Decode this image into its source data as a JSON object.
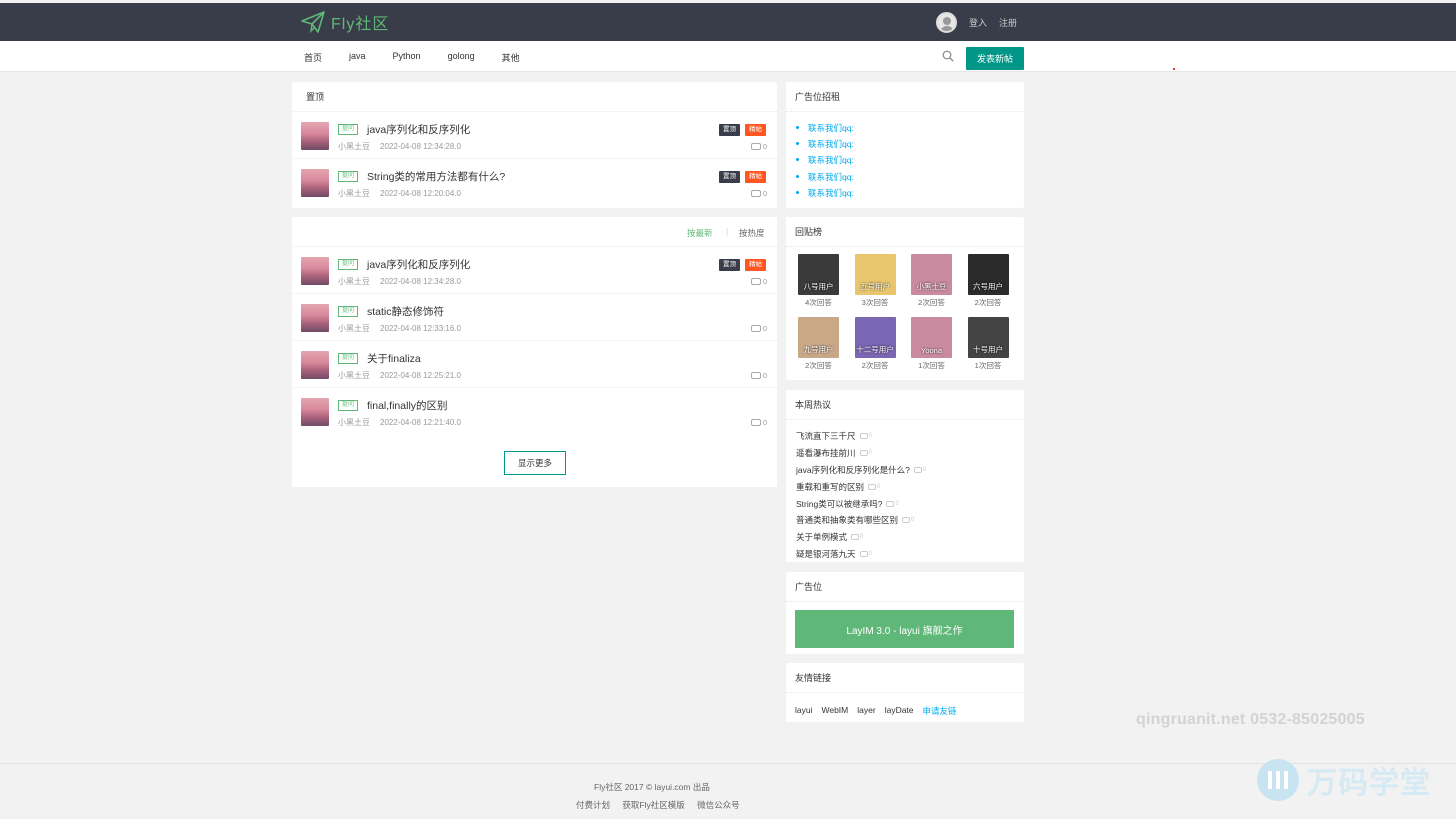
{
  "header": {
    "logo_text": "Fly社区",
    "login": "登入",
    "register": "注册"
  },
  "nav": {
    "items": [
      "首页",
      "java",
      "Python",
      "golong",
      "其他"
    ],
    "post_button": "发表新帖"
  },
  "top_panel": {
    "title": "置顶",
    "posts": [
      {
        "category": "提问",
        "title": "java序列化和反序列化",
        "author": "小黑土豆",
        "date": "2022-04-08 12:34:28.0",
        "badges": [
          "置顶",
          "精帖"
        ],
        "comments": "0"
      },
      {
        "category": "提问",
        "title": "String类的常用方法都有什么?",
        "author": "小黑土豆",
        "date": "2022-04-08 12:20:04.0",
        "badges": [
          "置顶",
          "精帖"
        ],
        "comments": "0"
      }
    ]
  },
  "list_panel": {
    "sort_latest": "按最新",
    "sort_sep": "|",
    "sort_hot": "按热度",
    "posts": [
      {
        "category": "提问",
        "title": "java序列化和反序列化",
        "author": "小黑土豆",
        "date": "2022-04-08 12:34:28.0",
        "badges": [
          "置顶",
          "精帖"
        ],
        "comments": "0"
      },
      {
        "category": "提问",
        "title": "static静态修饰符",
        "author": "小黑土豆",
        "date": "2022-04-08 12:33:16.0",
        "badges": [],
        "comments": "0"
      },
      {
        "category": "提问",
        "title": "关于finaliza",
        "author": "小黑土豆",
        "date": "2022-04-08 12:25:21.0",
        "badges": [],
        "comments": "0"
      },
      {
        "category": "提问",
        "title": "final,finally的区别",
        "author": "小黑土豆",
        "date": "2022-04-08 12:21:40.0",
        "badges": [],
        "comments": "0"
      }
    ],
    "more_button": "显示更多"
  },
  "ad_panel": {
    "title": "广告位招租",
    "links": [
      "联系我们qq:",
      "联系我们qq:",
      "联系我们qq:",
      "联系我们qq:",
      "联系我们qq:"
    ]
  },
  "reply_panel": {
    "title": "回贴榜",
    "users": [
      {
        "name": "八号用户",
        "count": "4次回答",
        "color": "#3a3a3a"
      },
      {
        "name": "五号用户",
        "count": "3次回答",
        "color": "#e9c66e"
      },
      {
        "name": "小黑土豆",
        "count": "2次回答",
        "color": "#c98aa0"
      },
      {
        "name": "六号用户",
        "count": "2次回答",
        "color": "#2b2b2b"
      },
      {
        "name": "九号用户",
        "count": "2次回答",
        "color": "#c9a888"
      },
      {
        "name": "十二号用户",
        "count": "2次回答",
        "color": "#7a66b2"
      },
      {
        "name": "Yoona",
        "count": "1次回答",
        "color": "#c98aa0"
      },
      {
        "name": "十号用户",
        "count": "1次回答",
        "color": "#444444"
      }
    ]
  },
  "hot_panel": {
    "title": "本周热议",
    "items": [
      {
        "title": "飞流直下三千尺",
        "count": "0"
      },
      {
        "title": "遥看瀑布挂前川",
        "count": "0"
      },
      {
        "title": "java序列化和反序列化是什么?",
        "count": "0"
      },
      {
        "title": "重载和重写的区别",
        "count": "0"
      },
      {
        "title": "String类可以被继承吗?",
        "count": "0"
      },
      {
        "title": "普通类和抽象类有哪些区别",
        "count": "0"
      },
      {
        "title": "关于单例模式",
        "count": "0"
      },
      {
        "title": "疑是银河落九天",
        "count": "0"
      }
    ]
  },
  "ad2_panel": {
    "title": "广告位",
    "banner": "LayIM 3.0 - layui 旗舰之作"
  },
  "friend_panel": {
    "title": "友情链接",
    "links": [
      "layui",
      "WebIM",
      "layer",
      "layDate"
    ],
    "apply": "申请友链"
  },
  "footer": {
    "line1": "Fly社区 2017 © layui.com 出品",
    "links": [
      "付费计划",
      "获取Fly社区模版",
      "微信公众号"
    ]
  },
  "watermark": {
    "text": "qingruanit.net 0532-85025005",
    "brand": "万码学堂"
  },
  "colors": {
    "header_bg": "#393d49",
    "accent_green": "#5fb878",
    "teal": "#009688",
    "hot_orange": "#ff5722",
    "link_blue": "#01aaed"
  }
}
